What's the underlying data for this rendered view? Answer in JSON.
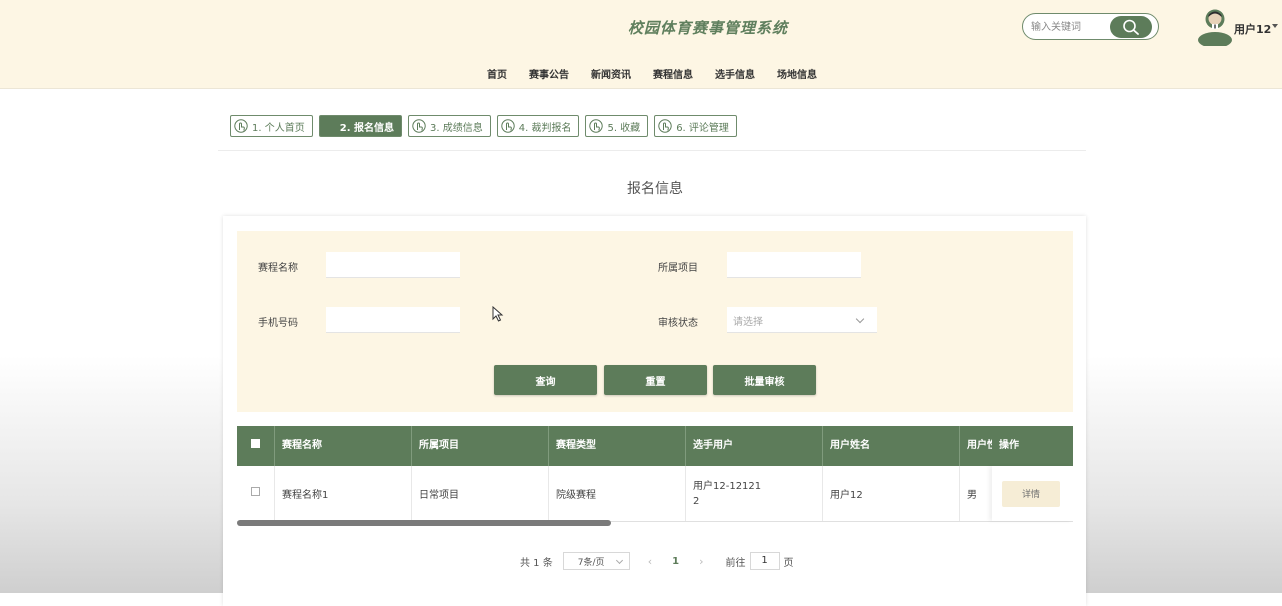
{
  "header": {
    "site_title": "校园体育赛事管理系统",
    "search_placeholder": "输入关键词",
    "user_name": "用户12",
    "search_icon": "search-icon",
    "avatar_icon": "user-avatar"
  },
  "nav": [
    "首页",
    "赛事公告",
    "新闻资讯",
    "赛程信息",
    "选手信息",
    "场地信息"
  ],
  "steps": [
    {
      "label": "1. 个人首页",
      "active": false
    },
    {
      "label": "2. 报名信息",
      "active": true
    },
    {
      "label": "3. 成绩信息",
      "active": false
    },
    {
      "label": "4. 裁判报名",
      "active": false
    },
    {
      "label": "5. 收藏",
      "active": false
    },
    {
      "label": "6. 评论管理",
      "active": false
    }
  ],
  "page_heading": "报名信息",
  "filter": {
    "match_name_label": "赛程名称",
    "project_label": "所属项目",
    "phone_label": "手机号码",
    "status_label": "审核状态",
    "status_placeholder": "请选择",
    "query_button": "查询",
    "reset_button": "重置",
    "batch_review_button": "批量审核"
  },
  "table": {
    "headers": [
      "赛程名称",
      "所属项目",
      "赛程类型",
      "选手用户",
      "用户姓名",
      "用户性",
      "操作"
    ],
    "rows": [
      {
        "match_name": "赛程名称1",
        "project": "日常项目",
        "match_type": "院级赛程",
        "player_user_line1": "用户12-12121",
        "player_user_line2": "2",
        "user_name": "用户12",
        "gender": "男",
        "action": "详情"
      }
    ]
  },
  "pagination": {
    "total": "共 1 条",
    "page_size": "7条/页",
    "current_page": "1",
    "goto_label": "前往",
    "goto_value": "1",
    "page_suffix": "页"
  },
  "colors": {
    "primary": "#5d7c5a",
    "header_bg": "#fdf6e4"
  }
}
